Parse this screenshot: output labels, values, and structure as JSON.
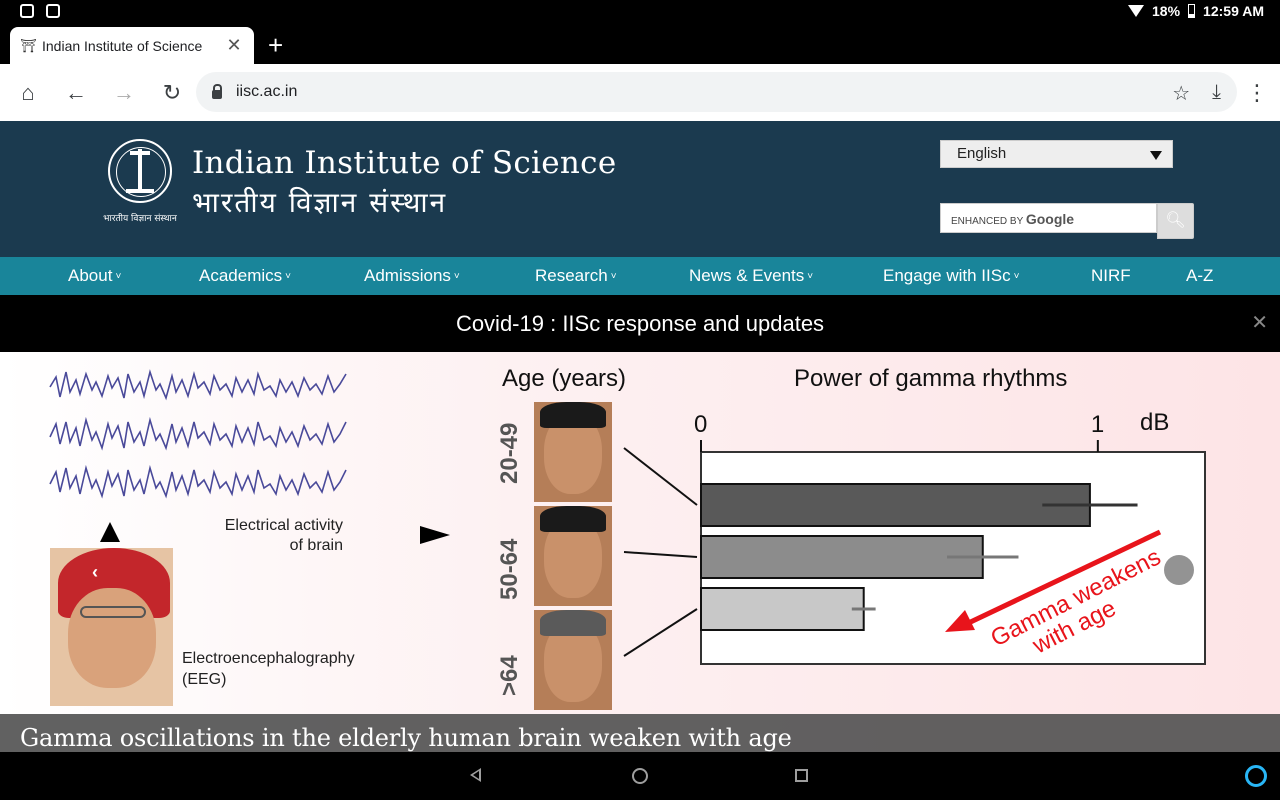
{
  "status_bar": {
    "battery": "18%",
    "time": "12:59 AM"
  },
  "browser": {
    "tab_title": "Indian Institute of Science",
    "new_tab": "+",
    "url": "iisc.ac.in"
  },
  "site": {
    "title": "Indian Institute of Science",
    "subtitle": "भारतीय विज्ञान संस्थान",
    "logo_text": "भारतीय विज्ञान संस्थान",
    "language": "English",
    "search_prefix": "ENHANCED BY",
    "search_brand": "Google",
    "nav": [
      {
        "label": "About",
        "caret": true
      },
      {
        "label": "Academics",
        "caret": true
      },
      {
        "label": "Admissions",
        "caret": true
      },
      {
        "label": "Research",
        "caret": true
      },
      {
        "label": "News & Events",
        "caret": true
      },
      {
        "label": "Engage with IISc",
        "caret": true
      },
      {
        "label": "NIRF",
        "caret": false
      },
      {
        "label": "A-Z",
        "caret": false
      }
    ],
    "covid_banner": "Covid-19 : IISc response and updates",
    "close_symbol": "✕"
  },
  "slide": {
    "eeg_caption_line1": "Electrical activity",
    "eeg_caption_line2": "of brain",
    "eeg_label_line1": "Electroencephalography",
    "eeg_label_line2": "(EEG)",
    "age_title": "Age (years)",
    "power_title": "Power of gamma rhythms",
    "age_groups": [
      "20-49",
      "50-64",
      ">64"
    ],
    "annotation_line1": "Gamma weakens",
    "annotation_line2": "with age",
    "caption": "Gamma oscillations in the elderly human brain weaken with age"
  },
  "chart_data": {
    "type": "bar",
    "orientation": "horizontal",
    "title": "Power of gamma rhythms",
    "ylabel": "Age (years)",
    "unit": "dB",
    "categories": [
      "20-49",
      "50-64",
      ">64"
    ],
    "values": [
      0.98,
      0.71,
      0.41
    ],
    "errors": [
      0.12,
      0.09,
      0.03
    ],
    "xlim": [
      0,
      1.27
    ],
    "xticks": [
      "0",
      "1"
    ],
    "bar_colors": [
      "#595959",
      "#8c8c8c",
      "#c8c8c8"
    ]
  },
  "colors": {
    "header_bg": "#1b3a4f",
    "nav_bg": "#19859a",
    "annotation": "#e8141b"
  }
}
